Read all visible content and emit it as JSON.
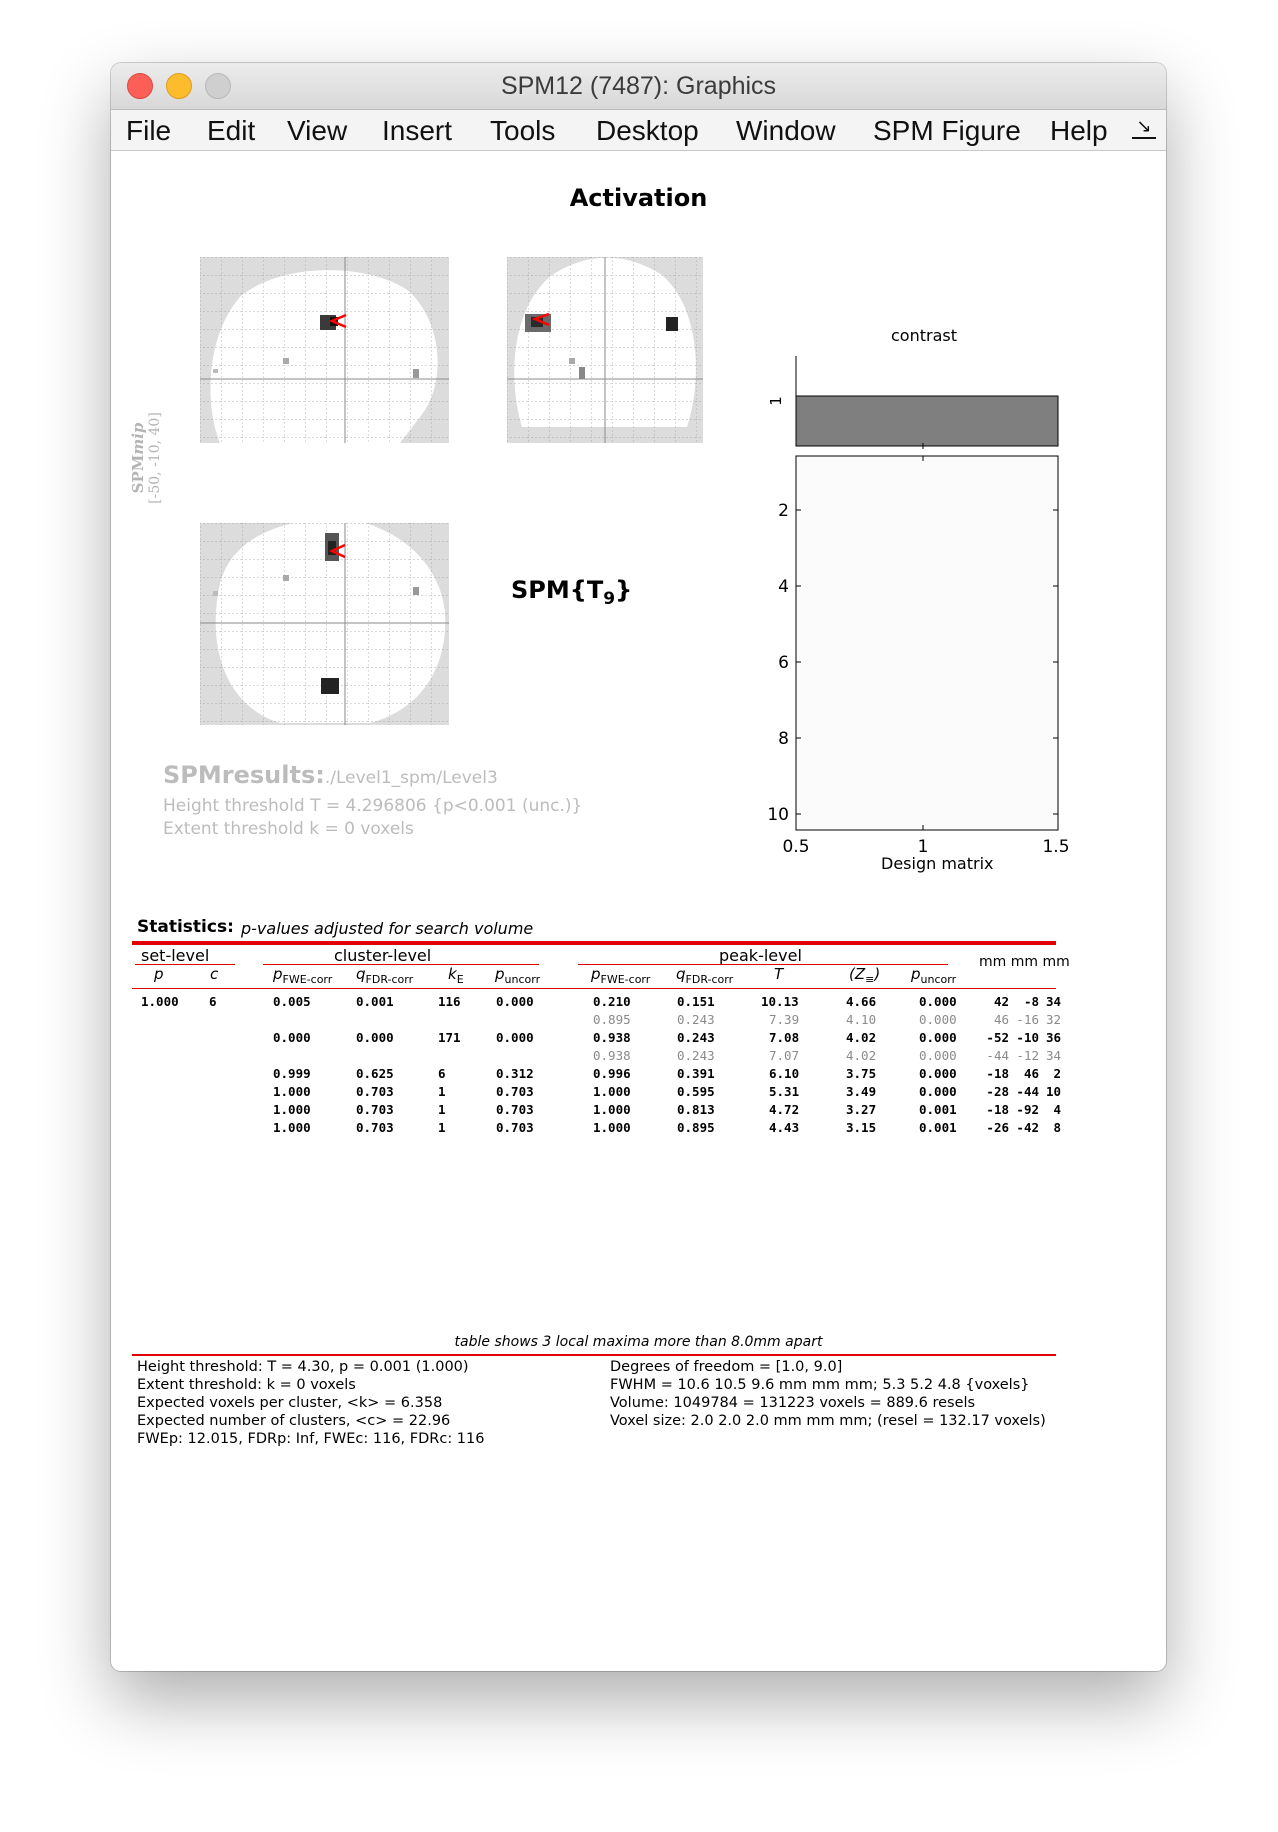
{
  "window": {
    "title": "SPM12 (7487): Graphics"
  },
  "menubar": {
    "items": [
      "File",
      "Edit",
      "View",
      "Insert",
      "Tools",
      "Desktop",
      "Window",
      "SPM Figure",
      "Help"
    ]
  },
  "figure": {
    "title": "Activation",
    "mip_label": {
      "line1": "SPMmip",
      "line1_italic": "mip",
      "line2": "[-50, -10, 40]"
    },
    "spm_stat": {
      "text": "SPM{T",
      "subscript": "9",
      "close": "}"
    },
    "results": {
      "label": "SPMresults:",
      "path": "./Level1_spm/Level3",
      "height_threshold": "Height threshold T = 4.296806  {p<0.001 (unc.)}",
      "extent_threshold": "Extent threshold k = 0 voxels"
    },
    "design": {
      "contrast_title": "contrast",
      "xlabel": "Design matrix",
      "contrast_ytick": "1",
      "yticks": [
        "2",
        "4",
        "6",
        "8",
        "10"
      ],
      "xticks": [
        "0.5",
        "1",
        "1.5"
      ],
      "contrast_bar_color": "#7f7f7f"
    }
  },
  "stats": {
    "title": "Statistics:",
    "subtitle": "p-values adjusted for search volume",
    "group_headers": {
      "set": "set-level",
      "cluster": "cluster-level",
      "peak": "peak-level",
      "coords": "mm mm mm"
    },
    "columns": {
      "set_p": "p",
      "set_c": "c",
      "c_pfwe": "p",
      "c_pfwe_sub": "FWE-corr",
      "c_qfdr": "q",
      "c_qfdr_sub": "FDR-corr",
      "c_ke": "k",
      "c_ke_sub": "E",
      "c_punc": "p",
      "c_punc_sub": "uncorr",
      "p_pfwe": "p",
      "p_pfwe_sub": "FWE-corr",
      "p_qfdr": "q",
      "p_qfdr_sub": "FDR-corr",
      "p_t": "T",
      "p_z": "(Z",
      "p_z_sub": "≡",
      "p_z_close": ")",
      "p_punc": "p",
      "p_punc_sub": "uncorr"
    },
    "rows": [
      {
        "kind": "main",
        "set_p": "1.000",
        "set_c": "6",
        "c_pfwe": "0.005",
        "c_qfdr": "0.001",
        "c_ke": "116",
        "c_punc": "0.000",
        "p_pfwe": "0.210",
        "p_qfdr": "0.151",
        "p_t": "10.13",
        "p_z": "4.66",
        "p_punc": "0.000",
        "x": "42",
        "y": "-8",
        "z": "34"
      },
      {
        "kind": "sub",
        "set_p": "",
        "set_c": "",
        "c_pfwe": "",
        "c_qfdr": "",
        "c_ke": "",
        "c_punc": "",
        "p_pfwe": "0.895",
        "p_qfdr": "0.243",
        "p_t": "7.39",
        "p_z": "4.10",
        "p_punc": "0.000",
        "x": "46",
        "y": "-16",
        "z": "32"
      },
      {
        "kind": "main",
        "set_p": "",
        "set_c": "",
        "c_pfwe": "0.000",
        "c_qfdr": "0.000",
        "c_ke": "171",
        "c_punc": "0.000",
        "p_pfwe": "0.938",
        "p_qfdr": "0.243",
        "p_t": "7.08",
        "p_z": "4.02",
        "p_punc": "0.000",
        "x": "-52",
        "y": "-10",
        "z": "36"
      },
      {
        "kind": "sub",
        "set_p": "",
        "set_c": "",
        "c_pfwe": "",
        "c_qfdr": "",
        "c_ke": "",
        "c_punc": "",
        "p_pfwe": "0.938",
        "p_qfdr": "0.243",
        "p_t": "7.07",
        "p_z": "4.02",
        "p_punc": "0.000",
        "x": "-44",
        "y": "-12",
        "z": "34"
      },
      {
        "kind": "main",
        "set_p": "",
        "set_c": "",
        "c_pfwe": "0.999",
        "c_qfdr": "0.625",
        "c_ke": "6",
        "c_punc": "0.312",
        "p_pfwe": "0.996",
        "p_qfdr": "0.391",
        "p_t": "6.10",
        "p_z": "3.75",
        "p_punc": "0.000",
        "x": "-18",
        "y": "46",
        "z": "2"
      },
      {
        "kind": "main",
        "set_p": "",
        "set_c": "",
        "c_pfwe": "1.000",
        "c_qfdr": "0.703",
        "c_ke": "1",
        "c_punc": "0.703",
        "p_pfwe": "1.000",
        "p_qfdr": "0.595",
        "p_t": "5.31",
        "p_z": "3.49",
        "p_punc": "0.000",
        "x": "-28",
        "y": "-44",
        "z": "10"
      },
      {
        "kind": "main",
        "set_p": "",
        "set_c": "",
        "c_pfwe": "1.000",
        "c_qfdr": "0.703",
        "c_ke": "1",
        "c_punc": "0.703",
        "p_pfwe": "1.000",
        "p_qfdr": "0.813",
        "p_t": "4.72",
        "p_z": "3.27",
        "p_punc": "0.001",
        "x": "-18",
        "y": "-92",
        "z": "4"
      },
      {
        "kind": "main",
        "set_p": "",
        "set_c": "",
        "c_pfwe": "1.000",
        "c_qfdr": "0.703",
        "c_ke": "1",
        "c_punc": "0.703",
        "p_pfwe": "1.000",
        "p_qfdr": "0.895",
        "p_t": "4.43",
        "p_z": "3.15",
        "p_punc": "0.001",
        "x": "-26",
        "y": "-42",
        "z": "8"
      }
    ],
    "footnote": "table shows 3 local maxima more than 8.0mm apart",
    "footer_left": [
      "Height threshold: T = 4.30, p = 0.001 (1.000)",
      "Extent threshold: k = 0 voxels",
      "Expected voxels per cluster, <k> = 6.358",
      "Expected number of clusters, <c> = 22.96",
      "FWEp: 12.015, FDRp: Inf, FWEc: 116, FDRc: 116"
    ],
    "footer_right": [
      "Degrees of freedom = [1.0, 9.0]",
      "FWHM = 10.6 10.5 9.6 mm mm mm; 5.3 5.2 4.8 {voxels}",
      "Volume: 1049784 = 131223 voxels = 889.6 resels",
      "Voxel size: 2.0 2.0 2.0 mm mm mm; (resel = 132.17 voxels)"
    ]
  }
}
